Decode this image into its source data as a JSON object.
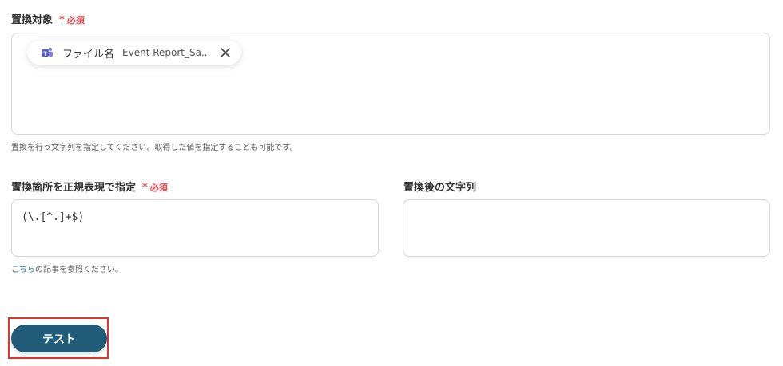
{
  "field1": {
    "label": "置換対象",
    "required": "必須",
    "chip": {
      "icon": "teams-icon",
      "name": "ファイル名",
      "value": "Event Report_Sa..."
    },
    "help": "置換を行う文字列を指定してください。取得した値を指定することも可能です。"
  },
  "field2": {
    "label": "置換箇所を正規表現で指定",
    "required": "必須",
    "value": "(\\.[^.]+$)",
    "help_link": "こちら",
    "help_rest": "の記事を参照ください。"
  },
  "field3": {
    "label": "置換後の文字列",
    "value": ""
  },
  "test_button": {
    "label": "テスト"
  },
  "colors": {
    "required": "#e0474c",
    "button": "#215c79",
    "link": "#2c6d8f",
    "highlight": "#e0362a"
  }
}
